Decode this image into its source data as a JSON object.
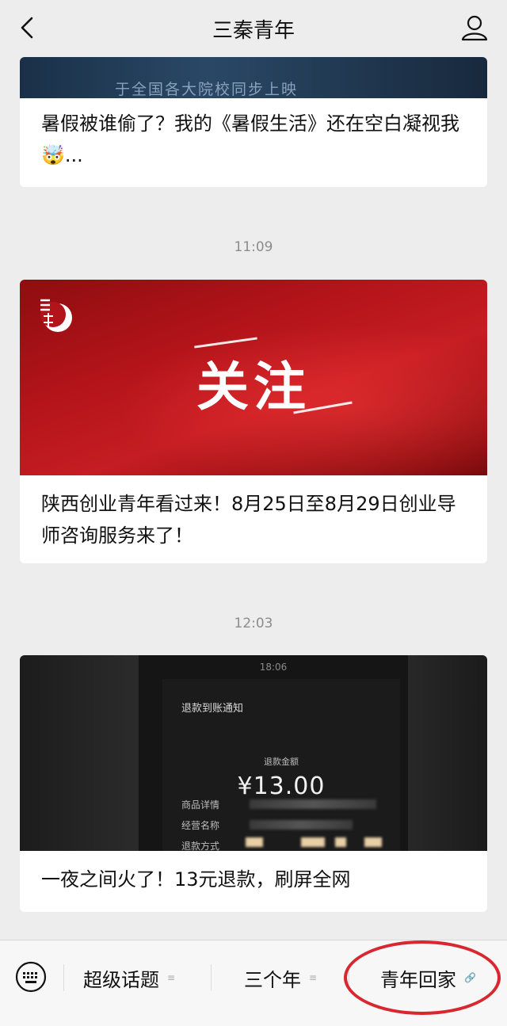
{
  "header": {
    "title": "三秦青年"
  },
  "articles": [
    {
      "banner_caption": "于全国各大院校同步上映",
      "title": "暑假被谁偷了？我的《暑假生活》还在空白凝视我🤯..."
    },
    {
      "timestamp": "11:09",
      "banner_text": "关注",
      "title": "陕西创业青年看过来！8月25日至8月29日创业导师咨询服务来了！"
    },
    {
      "timestamp": "12:03",
      "phone_time": "18:06",
      "notice_title": "退款到账通知",
      "refund_label": "退款金额",
      "refund_amount": "¥13.00",
      "detail_labels": [
        "商品详情",
        "经营名称",
        "退款方式"
      ],
      "title": "一夜之间火了！13元退款，刷屏全网"
    }
  ],
  "bottom_menu": {
    "items": [
      {
        "label": "超级话题",
        "glyph": "≡"
      },
      {
        "label": "三个年",
        "glyph": "≡"
      },
      {
        "label": "青年回家",
        "glyph": "🔗"
      }
    ]
  },
  "colors": {
    "background": "#ededed",
    "highlight_ring": "#d8272e",
    "banner_red": "#c51d22"
  }
}
